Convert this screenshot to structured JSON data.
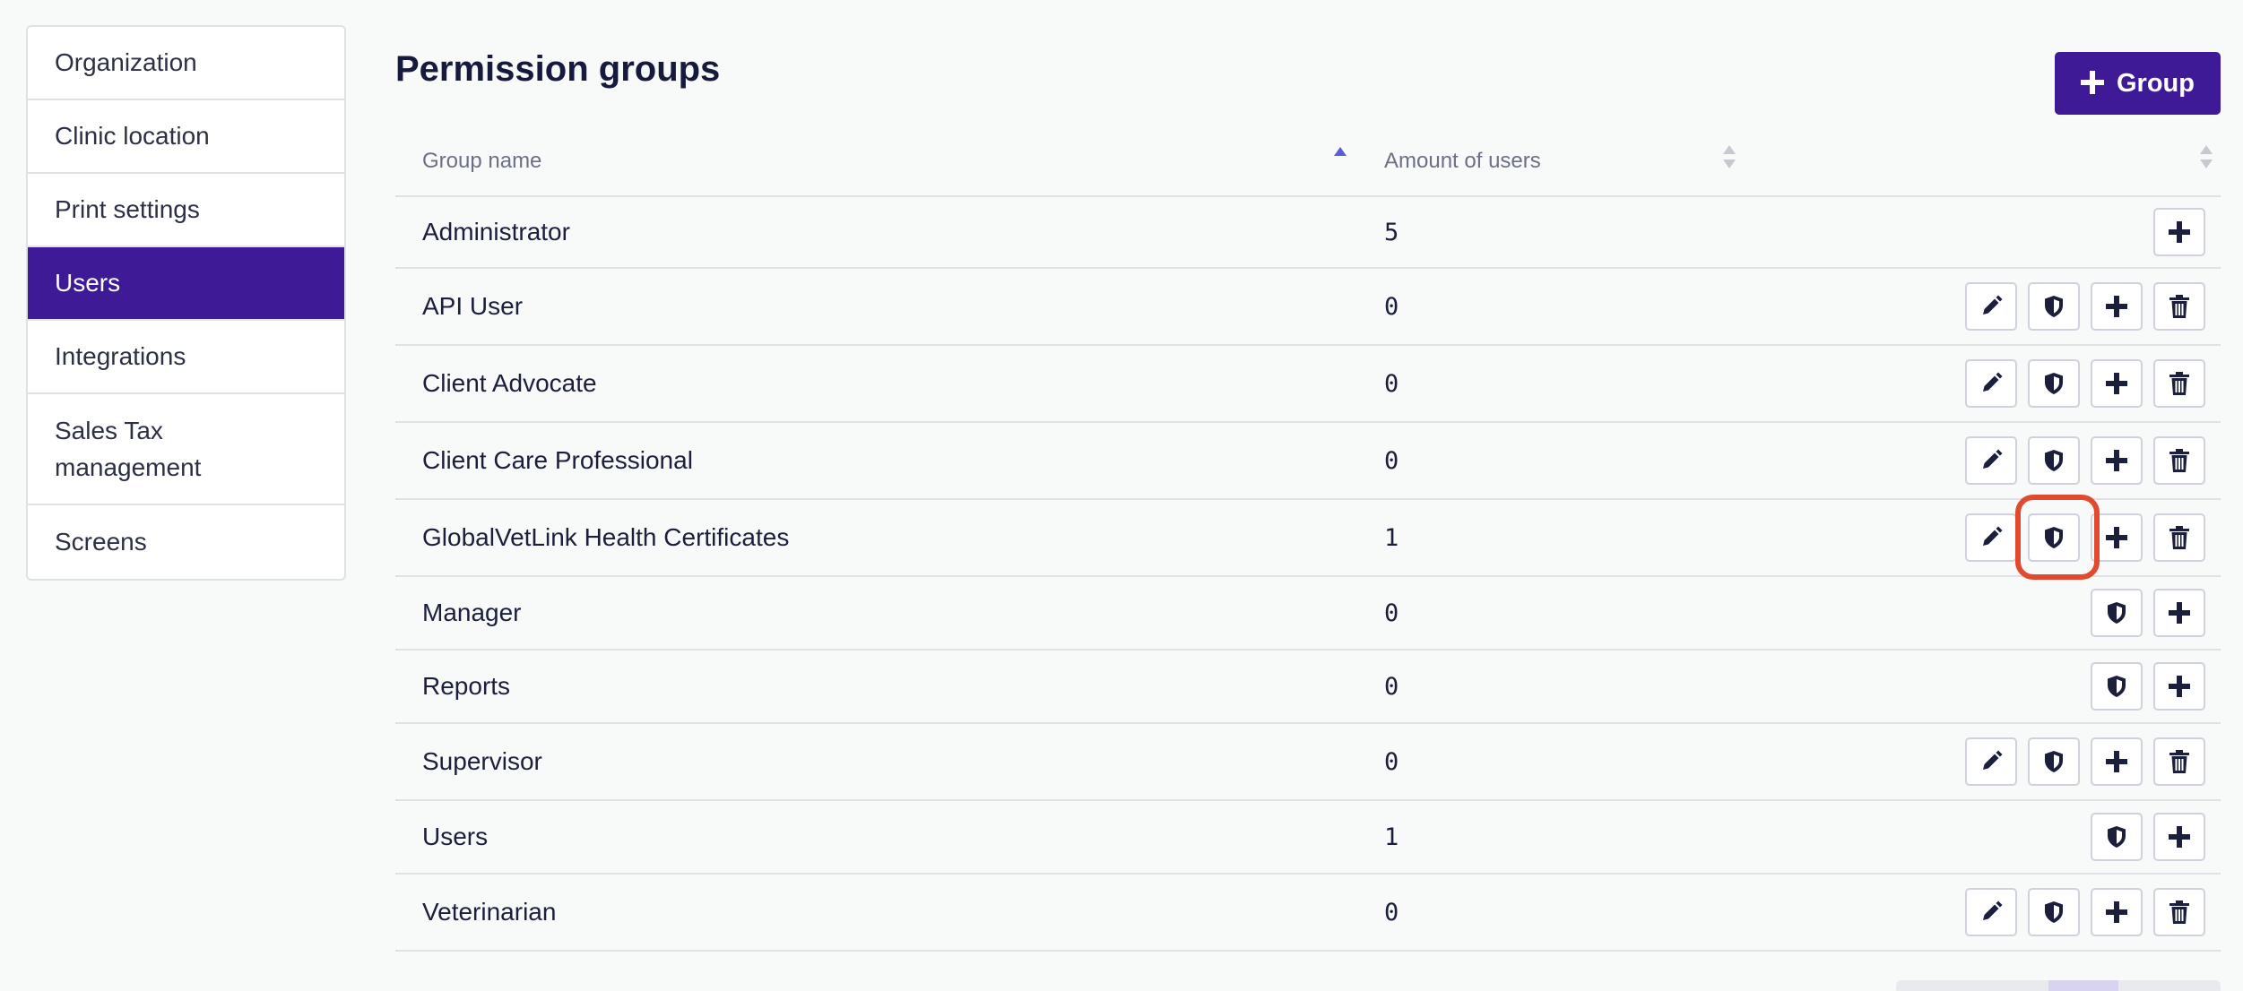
{
  "sidebar": {
    "items": [
      {
        "label": "Organization",
        "active": false
      },
      {
        "label": "Clinic location",
        "active": false
      },
      {
        "label": "Print settings",
        "active": false
      },
      {
        "label": "Users",
        "active": true
      },
      {
        "label": "Integrations",
        "active": false
      },
      {
        "label": "Sales Tax management",
        "active": false
      },
      {
        "label": "Screens",
        "active": false
      }
    ]
  },
  "header": {
    "title": "Permission groups",
    "add_button_label": "Group",
    "add_button_icon": "plus-icon"
  },
  "table": {
    "columns": [
      {
        "label": "Group name",
        "sort": "ascending"
      },
      {
        "label": "Amount of users",
        "sort": "none"
      },
      {
        "label": "",
        "sort": "none"
      }
    ],
    "rows": [
      {
        "name": "Administrator",
        "users": "5",
        "actions": [
          "add"
        ]
      },
      {
        "name": "API User",
        "users": "0",
        "actions": [
          "edit",
          "permissions",
          "add",
          "delete"
        ]
      },
      {
        "name": "Client Advocate",
        "users": "0",
        "actions": [
          "edit",
          "permissions",
          "add",
          "delete"
        ]
      },
      {
        "name": "Client Care Professional",
        "users": "0",
        "actions": [
          "edit",
          "permissions",
          "add",
          "delete"
        ]
      },
      {
        "name": "GlobalVetLink Health Certificates",
        "users": "1",
        "actions": [
          "edit",
          "permissions",
          "add",
          "delete"
        ]
      },
      {
        "name": "Manager",
        "users": "0",
        "actions": [
          "permissions",
          "add"
        ]
      },
      {
        "name": "Reports",
        "users": "0",
        "actions": [
          "permissions",
          "add"
        ]
      },
      {
        "name": "Supervisor",
        "users": "0",
        "actions": [
          "edit",
          "permissions",
          "add",
          "delete"
        ]
      },
      {
        "name": "Users",
        "users": "1",
        "actions": [
          "permissions",
          "add"
        ]
      },
      {
        "name": "Veterinarian",
        "users": "0",
        "actions": [
          "edit",
          "permissions",
          "add",
          "delete"
        ]
      }
    ]
  },
  "icons": {
    "edit": "pencil-icon",
    "permissions": "shield-icon",
    "add": "plus-icon",
    "delete": "trash-icon"
  },
  "colors": {
    "accent": "#3f1a96",
    "highlight": "#e24a2f",
    "sort_active": "#5b5fd6",
    "sort_inactive": "#c7c9d1"
  }
}
